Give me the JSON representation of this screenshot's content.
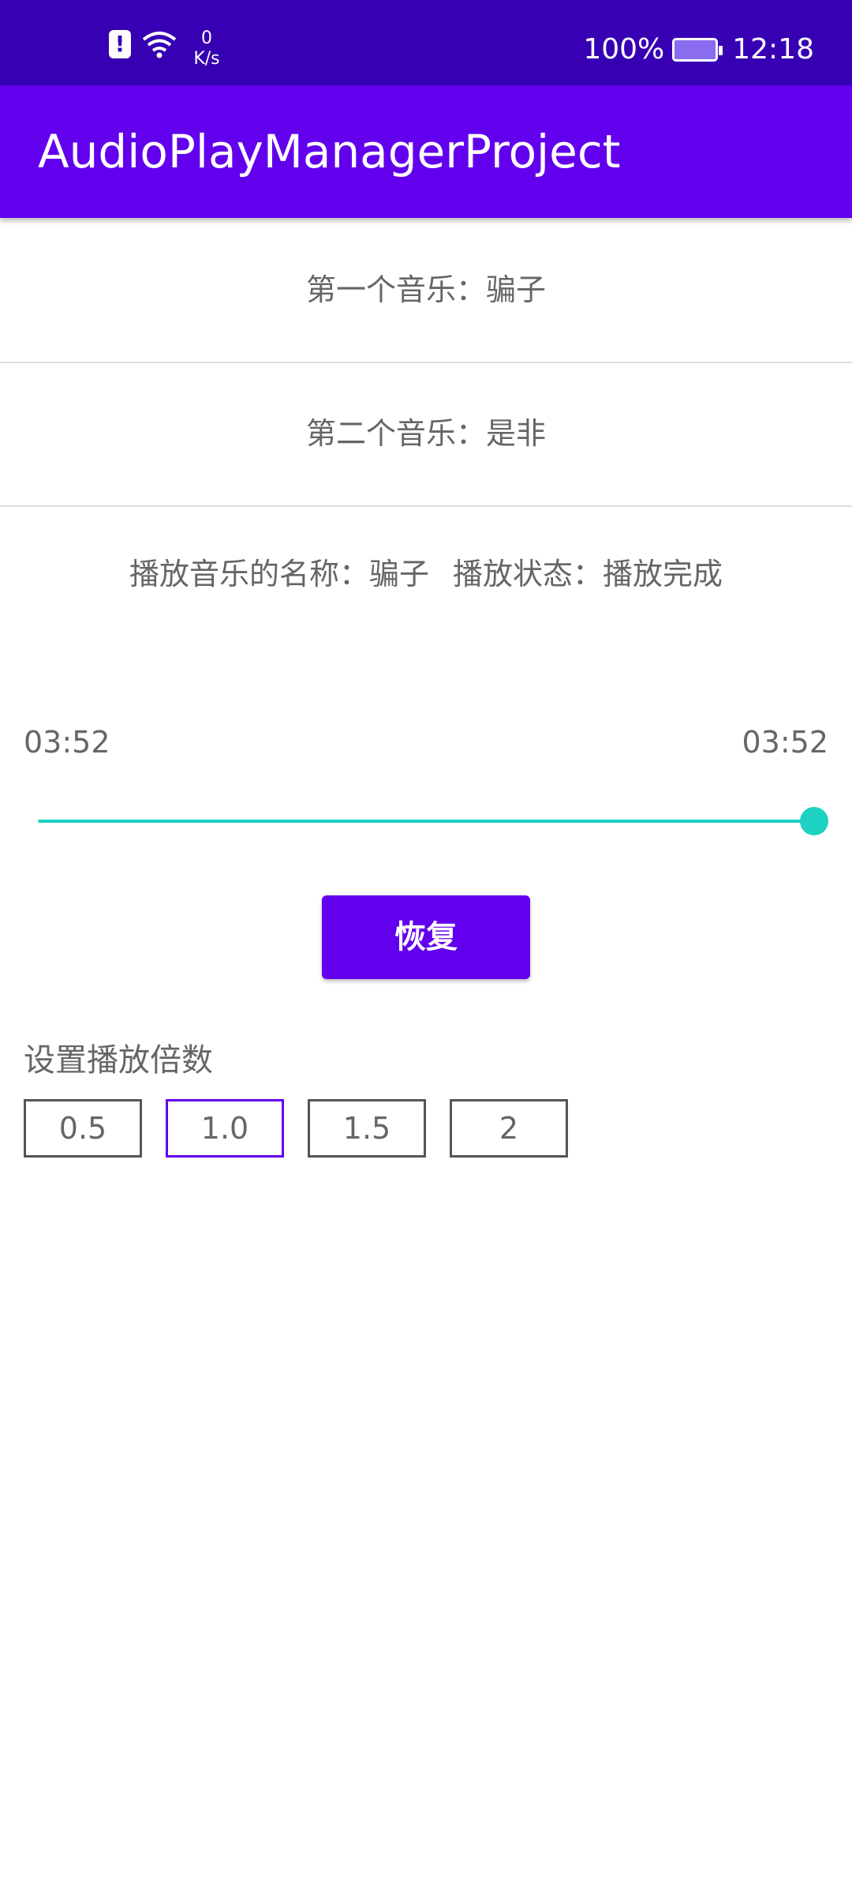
{
  "status_bar": {
    "net_speed_value": "0",
    "net_speed_unit": "K/s",
    "battery": "100%",
    "time": "12:18"
  },
  "app_bar": {
    "title": "AudioPlayManagerProject"
  },
  "tracks": [
    "第一个音乐：骗子",
    "第二个音乐：是非"
  ],
  "playback": {
    "name_text": "播放音乐的名称：骗子",
    "state_text": "播放状态：播放完成"
  },
  "progress": {
    "current_time": "03:52",
    "total_time": "03:52",
    "fraction": 1.0
  },
  "resume_button": "恢复",
  "speed": {
    "label": "设置播放倍数",
    "options": [
      "0.5",
      "1.0",
      "1.5",
      "2"
    ],
    "selected": "1.0"
  },
  "colors": {
    "status_bar": "#3700b3",
    "app_bar": "#6200ee",
    "accent": "#1ed2c1"
  }
}
